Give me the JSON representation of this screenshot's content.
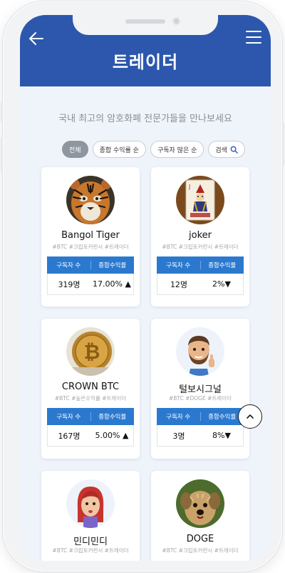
{
  "header": {
    "title": "트레이더"
  },
  "subtitle": "국내 최고의 암호화폐 전문가들을 만나보세요",
  "filters": {
    "all": "전체",
    "total_return": "종합 수익률 순",
    "subscribers": "구독자 많은 순",
    "search": "검색"
  },
  "stats_labels": {
    "subscribers": "구독자 수",
    "total_return": "종합수익률"
  },
  "traders": [
    {
      "name": "Bangol Tiger",
      "tags": "#BTC #크립토커런시 #트레이더",
      "subscribers": "319명",
      "return": "17.00%",
      "direction": "up"
    },
    {
      "name": "joker",
      "tags": "#BTC #크립토커런시 #트레이더",
      "subscribers": "12명",
      "return": "2%",
      "direction": "down"
    },
    {
      "name": "CROWN BTC",
      "tags": "#BTC #높은수익률 #트레이더",
      "subscribers": "167명",
      "return": "5.00%",
      "direction": "up"
    },
    {
      "name": "털보시그널",
      "tags": "#BTC #DOGE #트레이더",
      "subscribers": "3명",
      "return": "8%",
      "direction": "down"
    },
    {
      "name": "민디민디",
      "tags": "#BTC #크립토커런시 #트레이더"
    },
    {
      "name": "DOGE",
      "tags": "#BTC #크립토커런시 #트레이더"
    }
  ],
  "arrows": {
    "up": "▲",
    "down": "▼"
  },
  "colors": {
    "header": "#2c57ad",
    "stats_header": "#2b79cf",
    "return_up": "#1f58b0",
    "return_down": "#e22a2a"
  },
  "icons": [
    "back-arrow-icon",
    "hamburger-menu-icon",
    "search-icon",
    "chevron-up-icon"
  ]
}
